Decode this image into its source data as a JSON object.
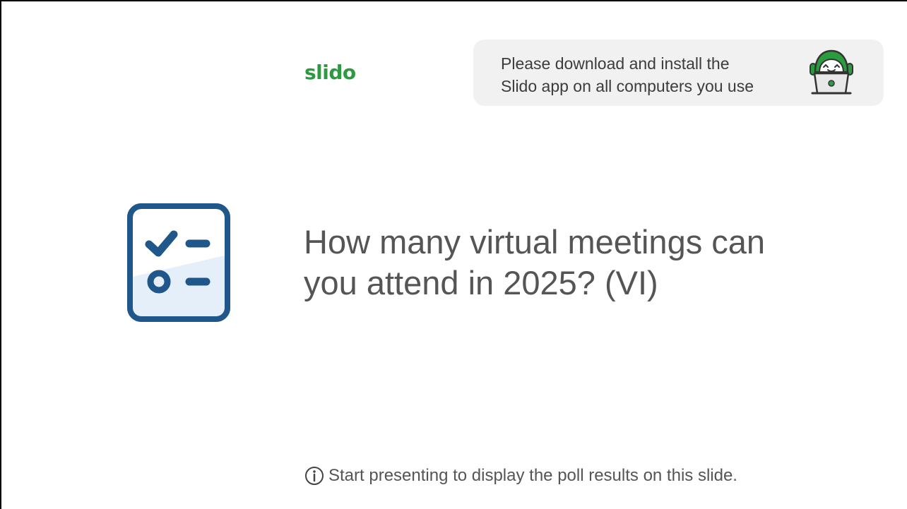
{
  "logo": {
    "text": "slido"
  },
  "notice": {
    "line1": "Please download and install the",
    "line2": "Slido app on all computers you use"
  },
  "question": {
    "line1": "How many virtual meetings can",
    "line2": "you attend in 2025? (VI)"
  },
  "footer": {
    "info_text": "Start presenting to display the poll results on this slide."
  },
  "icons": {
    "poll": "poll-checklist-icon",
    "mascot": "slido-laptop-mascot-icon",
    "info": "info-circle-icon"
  },
  "colors": {
    "brand_green": "#2c9a3f",
    "icon_blue": "#20578a",
    "text_gray": "#555555",
    "notice_bg": "#f1f1f1"
  }
}
